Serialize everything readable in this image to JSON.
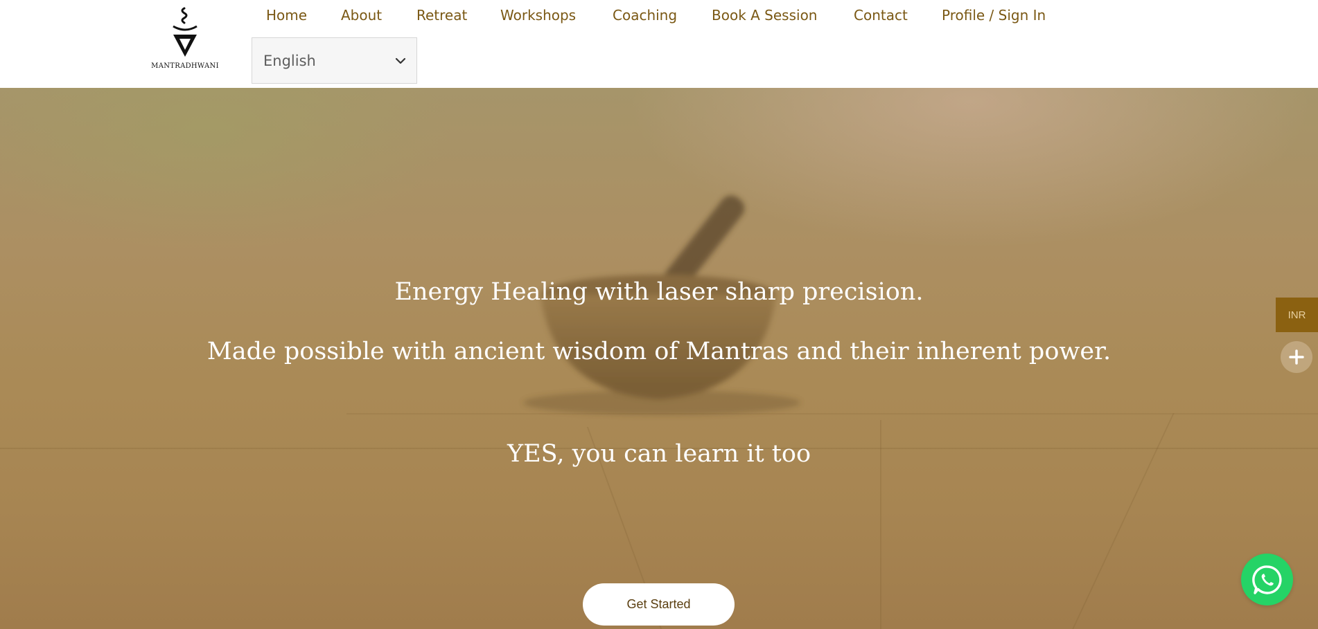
{
  "brand": {
    "name": "MANTRADHWANI"
  },
  "nav": {
    "items": [
      {
        "label": "Home"
      },
      {
        "label": "About"
      },
      {
        "label": "Retreat"
      },
      {
        "label": "Workshops"
      },
      {
        "label": "Coaching"
      },
      {
        "label": "Book A Session"
      },
      {
        "label": "Contact"
      },
      {
        "label": "Profile / Sign In"
      }
    ]
  },
  "language_select": {
    "value": "English"
  },
  "hero": {
    "line1": "Energy Healing with laser sharp precision.",
    "line2": "Made possible with ancient wisdom of Mantras and their inherent power.",
    "line3": "YES, you can learn it too",
    "cta_label": "Get Started"
  },
  "currency_switcher": {
    "label": "INR"
  },
  "colors": {
    "nav_text": "#7a5814",
    "accent": "#8b6111",
    "whatsapp": "#25d366"
  },
  "icons": {
    "expand": "plus-icon",
    "chat": "whatsapp-icon",
    "dropdown": "chevron-down-icon"
  }
}
